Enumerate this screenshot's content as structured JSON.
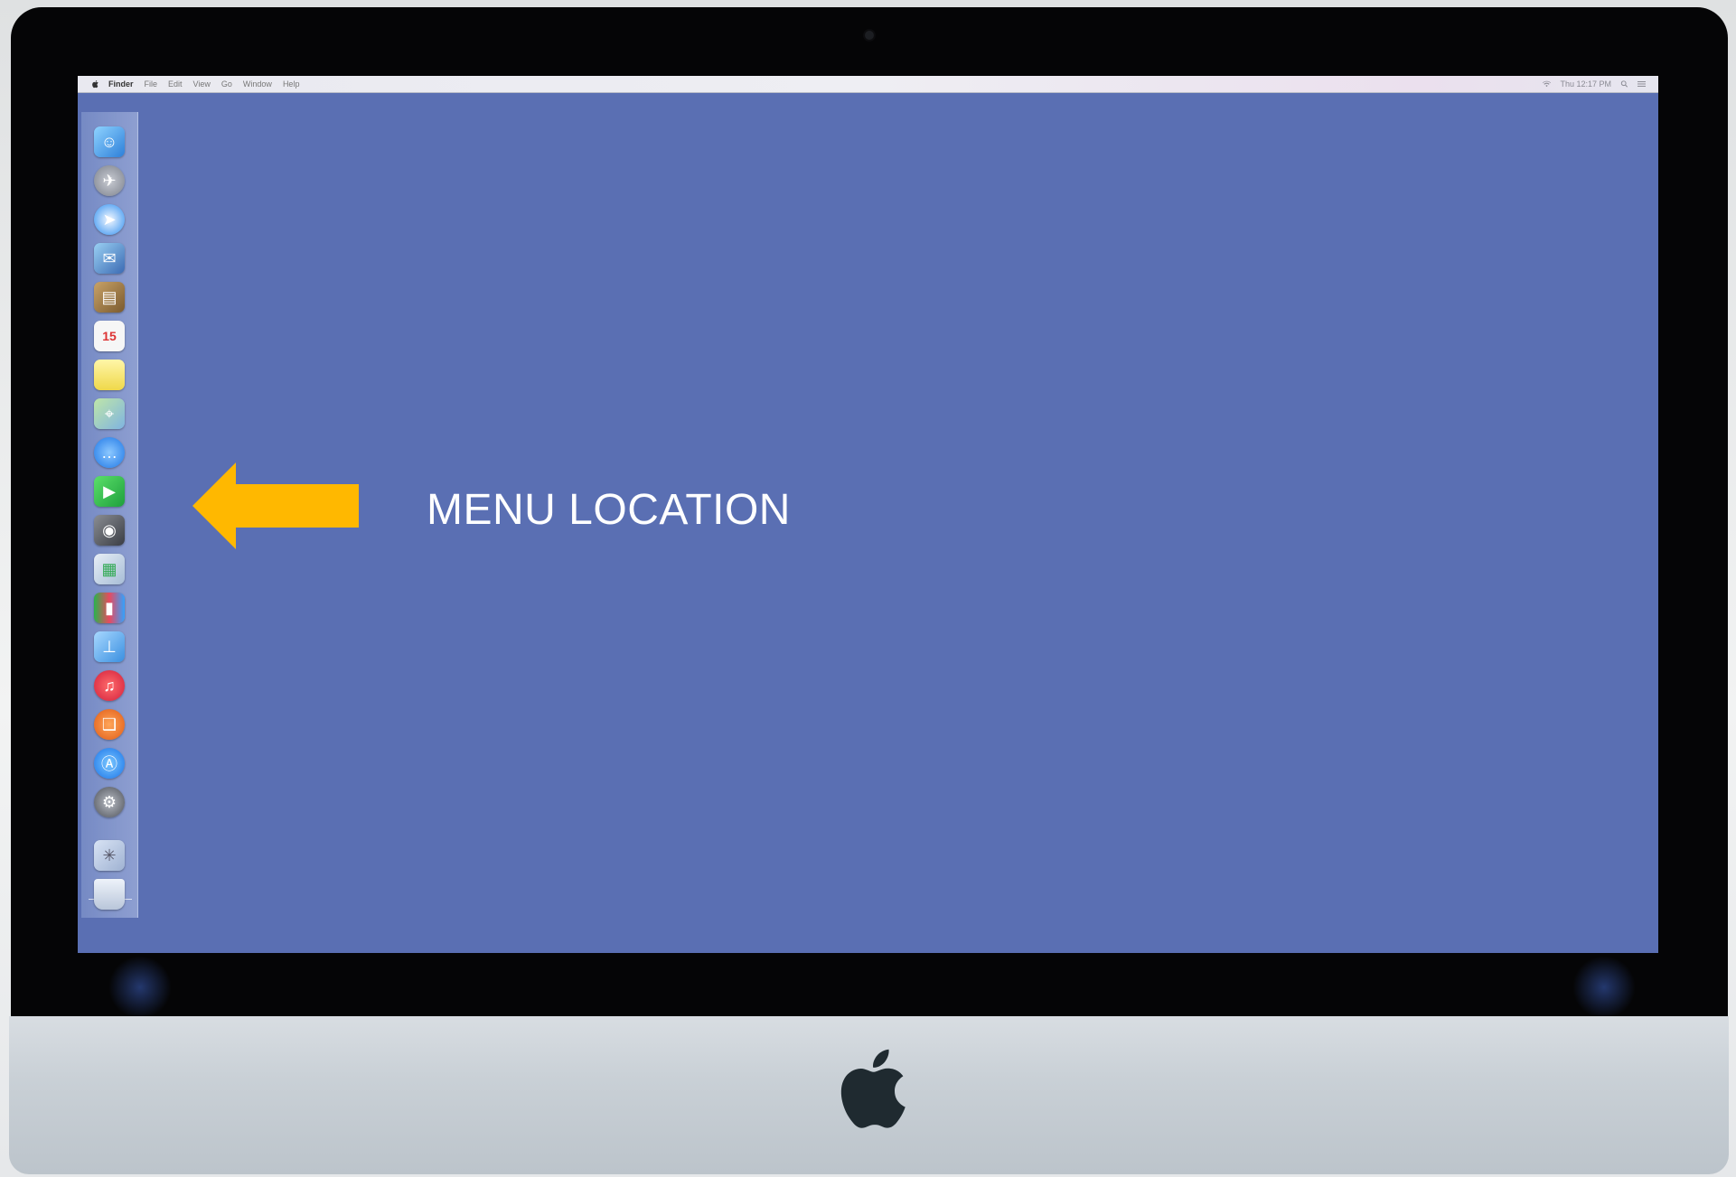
{
  "menubar": {
    "app_name": "Finder",
    "items": [
      "File",
      "Edit",
      "View",
      "Go",
      "Window",
      "Help"
    ],
    "clock": "Thu 12:17 PM"
  },
  "dock": {
    "icons": [
      "finder-icon",
      "launchpad-icon",
      "safari-icon",
      "mail-icon",
      "contacts-icon",
      "calendar-icon",
      "notes-icon",
      "maps-icon",
      "messages-icon",
      "facetime-icon",
      "photo-booth-icon",
      "preview-icon",
      "numbers-icon",
      "keynote-icon",
      "itunes-icon",
      "ibooks-icon",
      "app-store-icon",
      "system-preferences-icon",
      "downloads-icon",
      "trash-icon"
    ]
  },
  "annotation": {
    "label": "MENU LOCATION",
    "arrow_color": "#ffb800"
  },
  "colors": {
    "desktop": "#5a6fb3",
    "bezel": "#050506",
    "chin": "#c9d0d6"
  }
}
